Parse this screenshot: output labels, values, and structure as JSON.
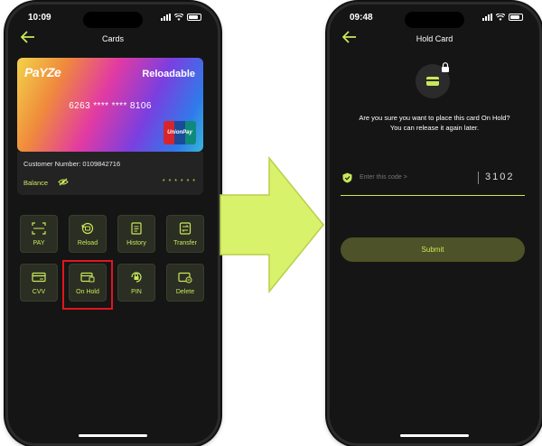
{
  "left_screen": {
    "status_time": "10:09",
    "title": "Cards",
    "card": {
      "brand": "PaYZe",
      "type": "Reloadable",
      "number": "6263 **** **** 8106",
      "network": "UnionPay"
    },
    "customer_number": "Customer Number: 0109842716",
    "balance_label": "Balance",
    "balance_masked": "* * * * * *",
    "actions": [
      {
        "label": "PAY",
        "icon": "qr-scan-icon"
      },
      {
        "label": "Reload",
        "icon": "reload-icon"
      },
      {
        "label": "History",
        "icon": "history-icon"
      },
      {
        "label": "Transfer",
        "icon": "transfer-icon"
      },
      {
        "label": "CVV",
        "icon": "cvv-card-icon"
      },
      {
        "label": "On Hold",
        "icon": "card-hold-icon"
      },
      {
        "label": "PIN",
        "icon": "pin-lock-icon"
      },
      {
        "label": "Delete",
        "icon": "delete-card-icon"
      }
    ],
    "highlighted_action": "On Hold"
  },
  "right_screen": {
    "status_time": "09:48",
    "title": "Hold Card",
    "question": "Are you sure you want to place this card On Hold?",
    "question_sub": "You can release it again later.",
    "code_placeholder": "Enter this code >",
    "code_value": "3102",
    "submit_label": "Submit"
  },
  "colors": {
    "accent": "#c9e85a",
    "background": "#151515",
    "highlight": "#e0161d",
    "arrow": "#d9f26b"
  }
}
